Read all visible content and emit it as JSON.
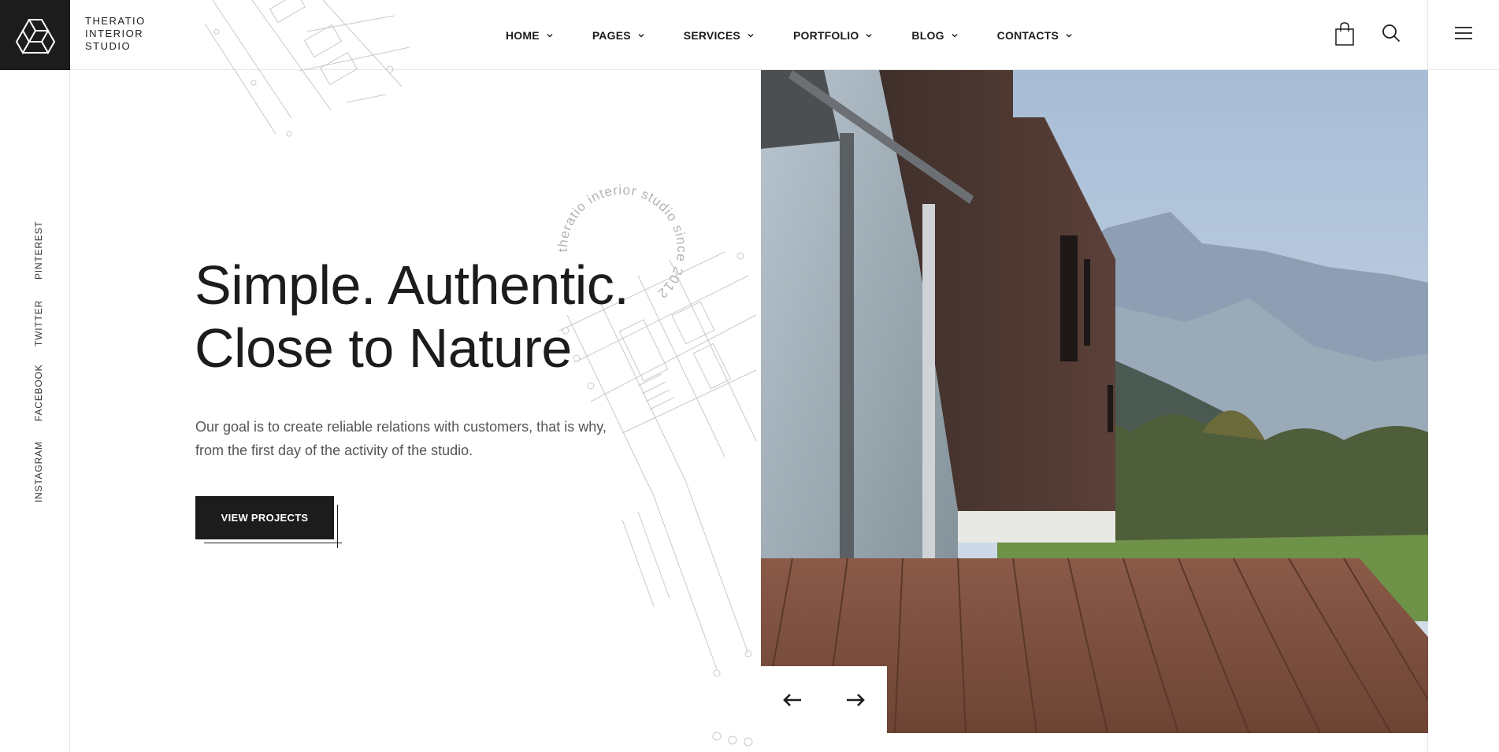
{
  "brand": {
    "line1": "THERATIO",
    "line2": "INTERIOR",
    "line3": "STUDIO"
  },
  "nav": [
    {
      "label": "HOME"
    },
    {
      "label": "PAGES"
    },
    {
      "label": "SERVICES"
    },
    {
      "label": "PORTFOLIO"
    },
    {
      "label": "BLOG"
    },
    {
      "label": "CONTACTS"
    }
  ],
  "social": [
    {
      "label": "PINTEREST"
    },
    {
      "label": "TWITTER"
    },
    {
      "label": "FACEBOOK"
    },
    {
      "label": "INSTAGRAM"
    }
  ],
  "hero": {
    "title_line1": "Simple. Authentic.",
    "title_line2": "Close to Nature",
    "description": "Our goal is to create reliable relations with customers, that is why, from the first day of the activity of the studio.",
    "cta_label": "VIEW PROJECTS",
    "stamp_text": "theratio interior studio since 2012"
  },
  "icons": {
    "logo": "logo-mark-icon",
    "bag": "shopping-bag-icon",
    "search": "search-icon",
    "menu": "hamburger-menu-icon",
    "prev": "arrow-left-icon",
    "next": "arrow-right-icon"
  },
  "colors": {
    "dark": "#1c1c1c",
    "text": "#555555",
    "border": "#e6e6e6"
  }
}
